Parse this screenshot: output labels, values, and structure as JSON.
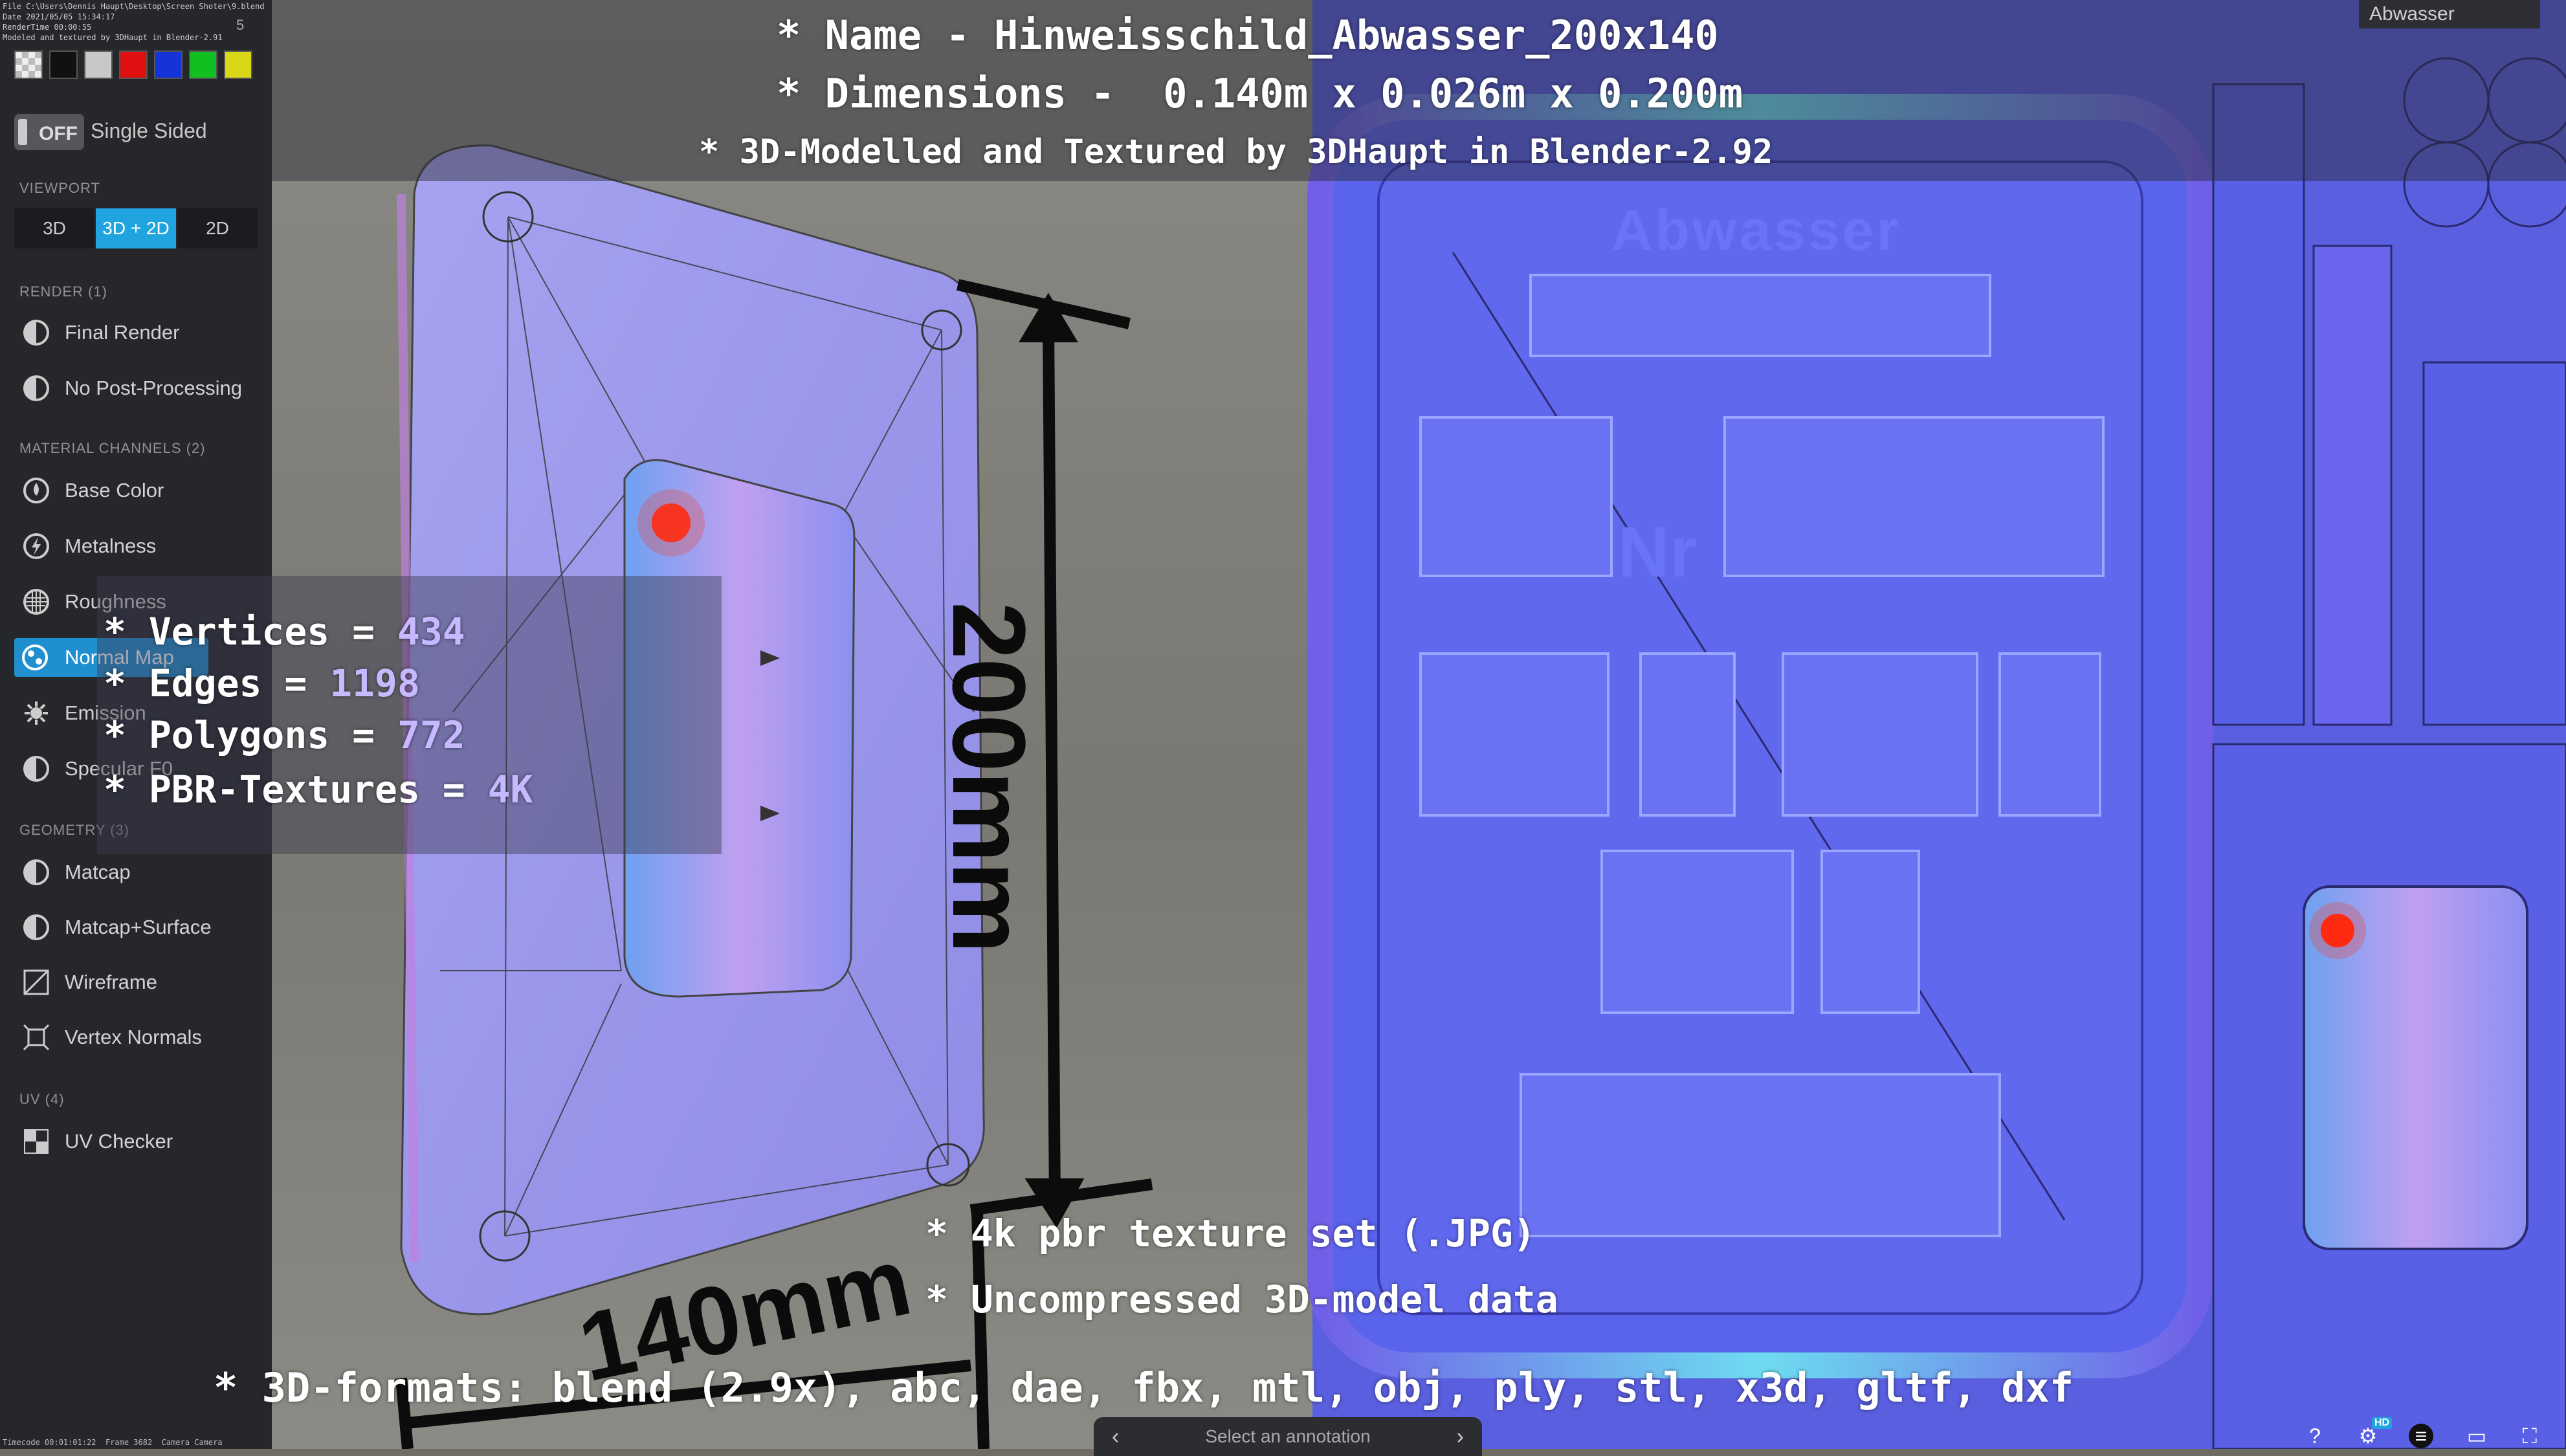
{
  "file_info": {
    "lines": [
      "File C:\\Users\\Dennis Haupt\\Desktop\\Screen Shoter\\9.blend",
      "Date 2021/05/05 15:34:17",
      "RenderTime 00:00:55",
      "Modeled and textured by 3DHaupt in Blender-2.91"
    ],
    "counter": "5"
  },
  "colors": {
    "swatches": [
      "#d8d8d8",
      "#111111",
      "#c8c8c8",
      "#e01010",
      "#1533d8",
      "#11c020",
      "#d8d816"
    ],
    "accent": "#1fa4df",
    "uv_background": "#5a5fe0"
  },
  "toggle": {
    "state_label": "OFF",
    "label": "Single Sided"
  },
  "viewport": {
    "heading": "VIEWPORT",
    "buttons": [
      {
        "label": "3D",
        "active": false
      },
      {
        "label": "3D + 2D",
        "active": true
      },
      {
        "label": "2D",
        "active": false
      }
    ]
  },
  "render": {
    "heading": "RENDER (1)",
    "items": [
      {
        "label": "Final Render",
        "icon": "circle-half-icon"
      },
      {
        "label": "No Post-Processing",
        "icon": "circle-half-icon"
      }
    ]
  },
  "material": {
    "heading": "MATERIAL CHANNELS (2)",
    "items": [
      {
        "label": "Base Color",
        "icon": "color-drop-icon"
      },
      {
        "label": "Metalness",
        "icon": "lightning-icon"
      },
      {
        "label": "Roughness",
        "icon": "grid-circle-icon"
      },
      {
        "label": "Normal Map",
        "icon": "normal-map-icon",
        "active": true
      },
      {
        "label": "Emission",
        "icon": "sun-icon"
      },
      {
        "label": "Specular F0",
        "icon": "circle-half-icon"
      }
    ]
  },
  "geometry": {
    "heading": "GEOMETRY (3)",
    "items": [
      {
        "label": "Matcap",
        "icon": "circle-half-icon"
      },
      {
        "label": "Matcap+Surface",
        "icon": "circle-half-icon"
      },
      {
        "label": "Wireframe",
        "icon": "wireframe-icon"
      },
      {
        "label": "Vertex Normals",
        "icon": "vertex-normals-icon"
      }
    ]
  },
  "uv": {
    "heading": "UV (4)",
    "items": [
      {
        "label": "UV Checker",
        "icon": "checker-icon"
      }
    ]
  },
  "overlay": {
    "name_line": "* Name - Hinweisschild_Abwasser_200x140",
    "dims_line": "* Dimensions -  0.140m x 0.026m x 0.200m",
    "credit_line": "* 3D-Modelled and Textured by 3DHaupt in Blender-2.92",
    "stats": [
      {
        "label": "* Vertices = ",
        "value": "434"
      },
      {
        "label": "* Edges = ",
        "value": "1198"
      },
      {
        "label": "* Polygons = ",
        "value": "772"
      },
      {
        "label": "* PBR-Textures = ",
        "value": "4K"
      }
    ],
    "texture_line": "* 4k pbr texture set (.JPG)",
    "uncompressed_line": "* Uncompressed 3D-model data",
    "formats_line": "* 3D-formats: blend (2.9x), abc, dae, fbx, mtl, obj, ply, stl, x3d, gltf, dxf"
  },
  "scene": {
    "dimension_vertical": "200mm",
    "dimension_horizontal": "140mm",
    "uv_sign_text_1": "Abwasser",
    "uv_sign_text_2": "Nr"
  },
  "corner_label": "Abwasser",
  "annotation_bar": {
    "prev": "‹",
    "label": "Select an annotation",
    "next": "›"
  },
  "footer": {
    "timecode": "Timecode 00:01:01:22",
    "frame": "Frame 3682",
    "camera": "Camera Camera"
  },
  "bottom_icons": [
    "help-icon",
    "settings-icon",
    "layers-icon",
    "image-icon",
    "fullscreen-icon"
  ],
  "hd_badge": "HD"
}
